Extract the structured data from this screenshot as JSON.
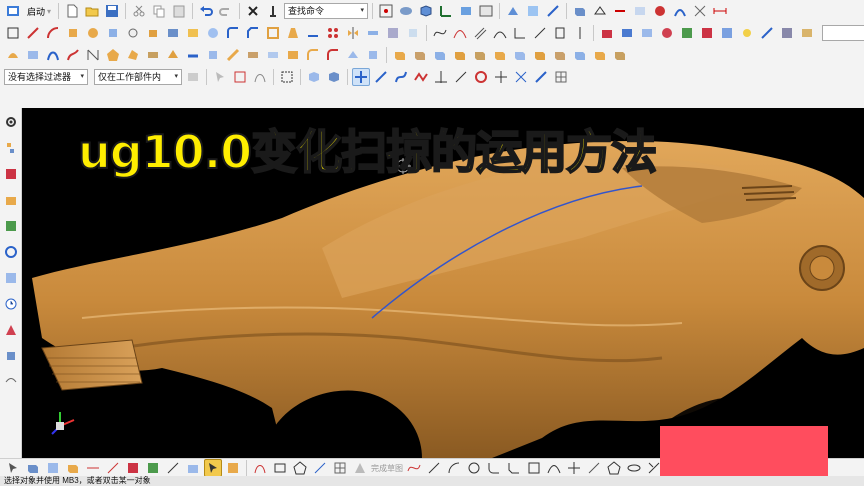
{
  "toolbar": {
    "start_label": "启动",
    "command_search_placeholder": "查找命令",
    "selection_filter": "没有选择过滤器",
    "selection_scope": "仅在工作部件内"
  },
  "video_overlay": {
    "title": "ug10.0变化扫掠的运用方法",
    "title_color": "#ffee00",
    "cover_color": "#ff4d5e"
  },
  "viewport": {
    "background": "#000000",
    "model_color": "#c98a3c",
    "curve_color": "#3355cc"
  },
  "bottom_toolbar": {
    "inactive_label": "完成草图"
  },
  "status_bar": {
    "message": "选择对象并使用 MB3，或者双击某一对象"
  }
}
